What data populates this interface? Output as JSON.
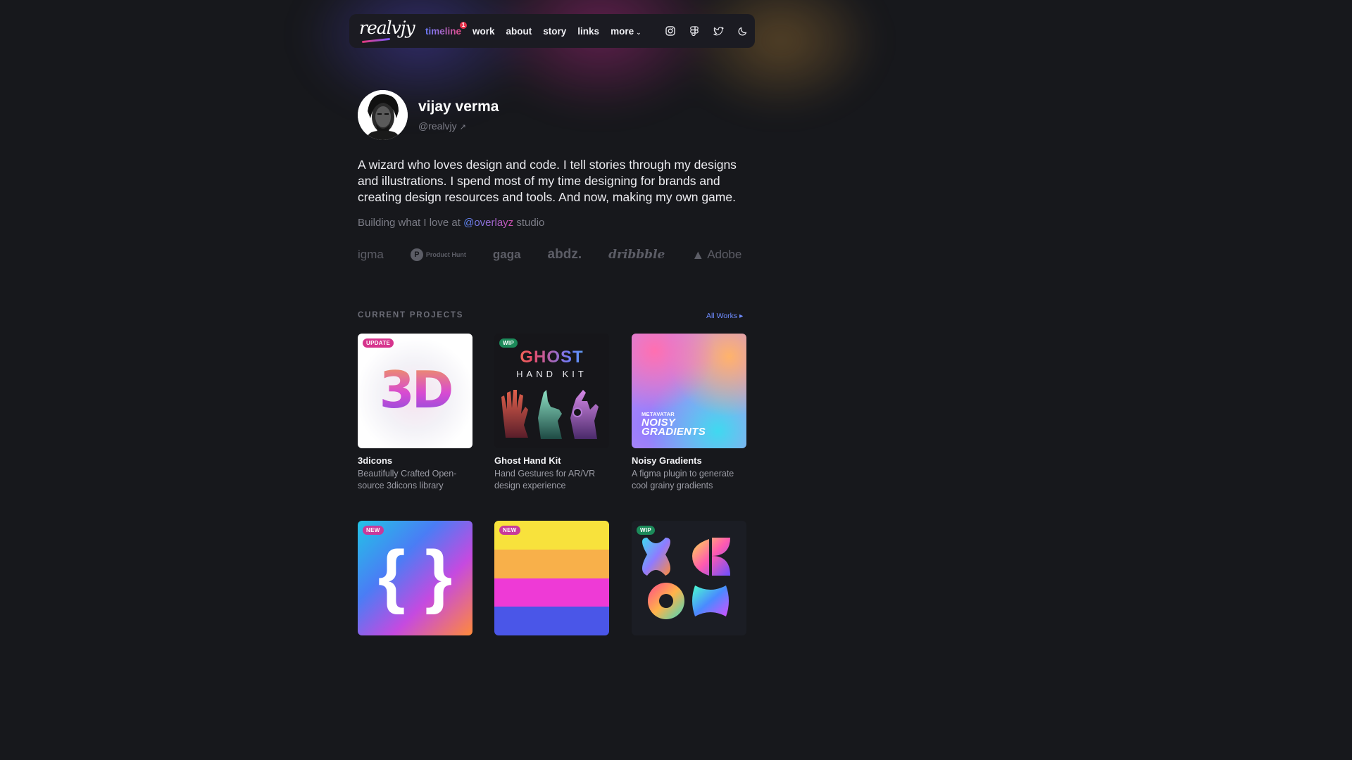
{
  "brand": {
    "logo_text": "realvjy"
  },
  "nav": {
    "links": [
      {
        "label": "timeline",
        "badge": "1"
      },
      {
        "label": "work"
      },
      {
        "label": "about"
      },
      {
        "label": "story"
      },
      {
        "label": "links"
      },
      {
        "label": "more"
      }
    ],
    "icons": [
      "instagram-icon",
      "figma-icon",
      "twitter-icon",
      "moon-icon"
    ]
  },
  "profile": {
    "name": "vijay verma",
    "handle": "@realvjy"
  },
  "bio": "A wizard who loves design and code. I tell stories through my designs and illustrations. I spend most of my time designing for brands and creating design resources and tools. And now, making my own game.",
  "building": {
    "prefix": "Building what I love at",
    "link": "@overlayz",
    "suffix": "studio"
  },
  "brands": [
    "igma",
    "Product Hunt",
    "gaga",
    "abdz.",
    "dribbble",
    "Adobe"
  ],
  "projects_section": {
    "title": "CURRENT PROJECTS",
    "all_works": "All Works ▸"
  },
  "projects": [
    {
      "title": "3dicons",
      "desc": "Beautifully Crafted Open-source 3dicons library",
      "tag": "UPDATE",
      "art": "3D"
    },
    {
      "title": "Ghost Hand Kit",
      "desc": "Hand Gestures for AR/VR design experience",
      "tag": "WIP",
      "art_title": "GHOST",
      "art_sub": "HAND KIT"
    },
    {
      "title": "Noisy Gradients",
      "desc": "A figma plugin to generate cool grainy gradients",
      "tag": "",
      "art_brand": "METAVATAR",
      "art_title_1": "NOISY",
      "art_title_2": "GRADIENTS"
    },
    {
      "tag": "NEW",
      "art": "{ }"
    },
    {
      "tag": "NEW",
      "stripes": [
        "#f8e23c",
        "#f8b04a",
        "#ee3ad6",
        "#4a56e8"
      ]
    },
    {
      "tag": "WIP"
    }
  ],
  "colors": {
    "accent": "#6f8cff",
    "background": "#17181c",
    "badge": "#e8344e"
  }
}
